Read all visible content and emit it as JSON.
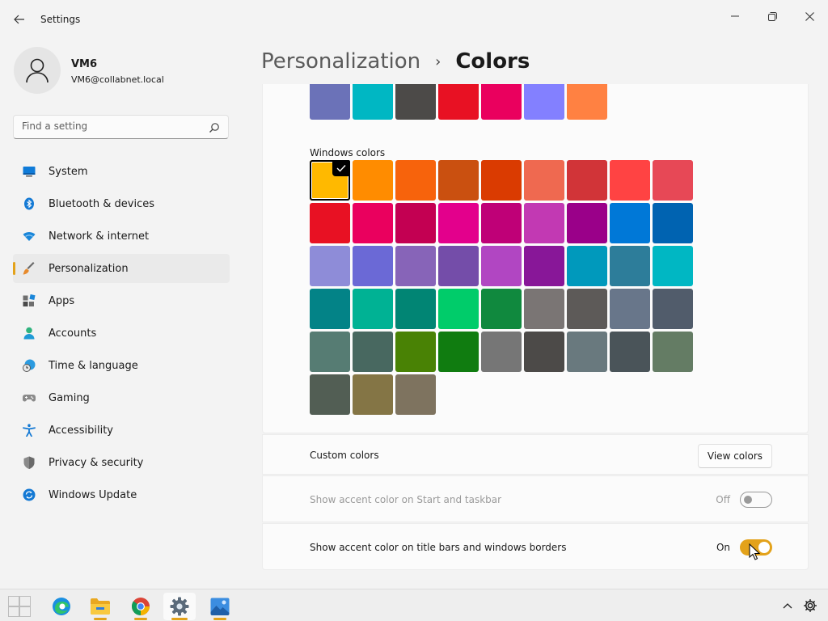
{
  "app": {
    "title": "Settings"
  },
  "user": {
    "name": "VM6",
    "email": "VM6@collabnet.local"
  },
  "search": {
    "placeholder": "Find a setting"
  },
  "nav": {
    "items": [
      {
        "label": "System",
        "icon": "system-icon"
      },
      {
        "label": "Bluetooth & devices",
        "icon": "bluetooth-icon"
      },
      {
        "label": "Network & internet",
        "icon": "network-icon"
      },
      {
        "label": "Personalization",
        "icon": "brush-icon",
        "active": true
      },
      {
        "label": "Apps",
        "icon": "apps-icon"
      },
      {
        "label": "Accounts",
        "icon": "accounts-icon"
      },
      {
        "label": "Time & language",
        "icon": "clock-globe-icon"
      },
      {
        "label": "Gaming",
        "icon": "controller-icon"
      },
      {
        "label": "Accessibility",
        "icon": "accessibility-icon"
      },
      {
        "label": "Privacy & security",
        "icon": "shield-icon"
      },
      {
        "label": "Windows Update",
        "icon": "update-icon"
      }
    ]
  },
  "breadcrumb": {
    "parent": "Personalization",
    "separator": "›",
    "current": "Colors"
  },
  "recent_colors": [
    "#6b72b8",
    "#00b7c3",
    "#4c4a48",
    "#e81123",
    "#ea005e",
    "#8380ff",
    "#ff8142"
  ],
  "windows_colors": {
    "label": "Windows colors",
    "selected_index": 0,
    "colors": [
      "#ffb900",
      "#ff8c00",
      "#f7630c",
      "#ca5010",
      "#da3b01",
      "#ef6950",
      "#d13438",
      "#ff4343",
      "#e74856",
      "#e81123",
      "#ea005e",
      "#c30052",
      "#e3008c",
      "#bf0077",
      "#c239b3",
      "#9a0089",
      "#0078d7",
      "#0063b1",
      "#8e8cd8",
      "#6b69d6",
      "#8764b8",
      "#744da9",
      "#b146c2",
      "#881798",
      "#0099bc",
      "#2d7d9a",
      "#00b7c3",
      "#038387",
      "#00b294",
      "#018574",
      "#00cc6a",
      "#10893e",
      "#7a7574",
      "#5d5a58",
      "#68768a",
      "#515c6b",
      "#567c73",
      "#486860",
      "#498205",
      "#107c10",
      "#767676",
      "#4c4a48",
      "#69797e",
      "#4a5459",
      "#647c64",
      "#525e54",
      "#847545",
      "#7e735f"
    ]
  },
  "custom_colors": {
    "label": "Custom colors",
    "button": "View colors"
  },
  "accent_start": {
    "label": "Show accent color on Start and taskbar",
    "state_text": "Off",
    "on": false
  },
  "accent_titlebars": {
    "label": "Show accent color on title bars and windows borders",
    "state_text": "On",
    "on": true
  },
  "accent_color": "#e3a21a",
  "taskbar": {
    "items": [
      {
        "name": "start-button",
        "icon": "windows-logo-icon"
      },
      {
        "name": "taskbar-edge",
        "icon": "edge-icon"
      },
      {
        "name": "taskbar-file-explorer",
        "icon": "folder-icon"
      },
      {
        "name": "taskbar-chrome",
        "icon": "chrome-icon"
      },
      {
        "name": "taskbar-settings",
        "icon": "gear-icon"
      },
      {
        "name": "taskbar-photos",
        "icon": "photos-icon"
      }
    ]
  }
}
